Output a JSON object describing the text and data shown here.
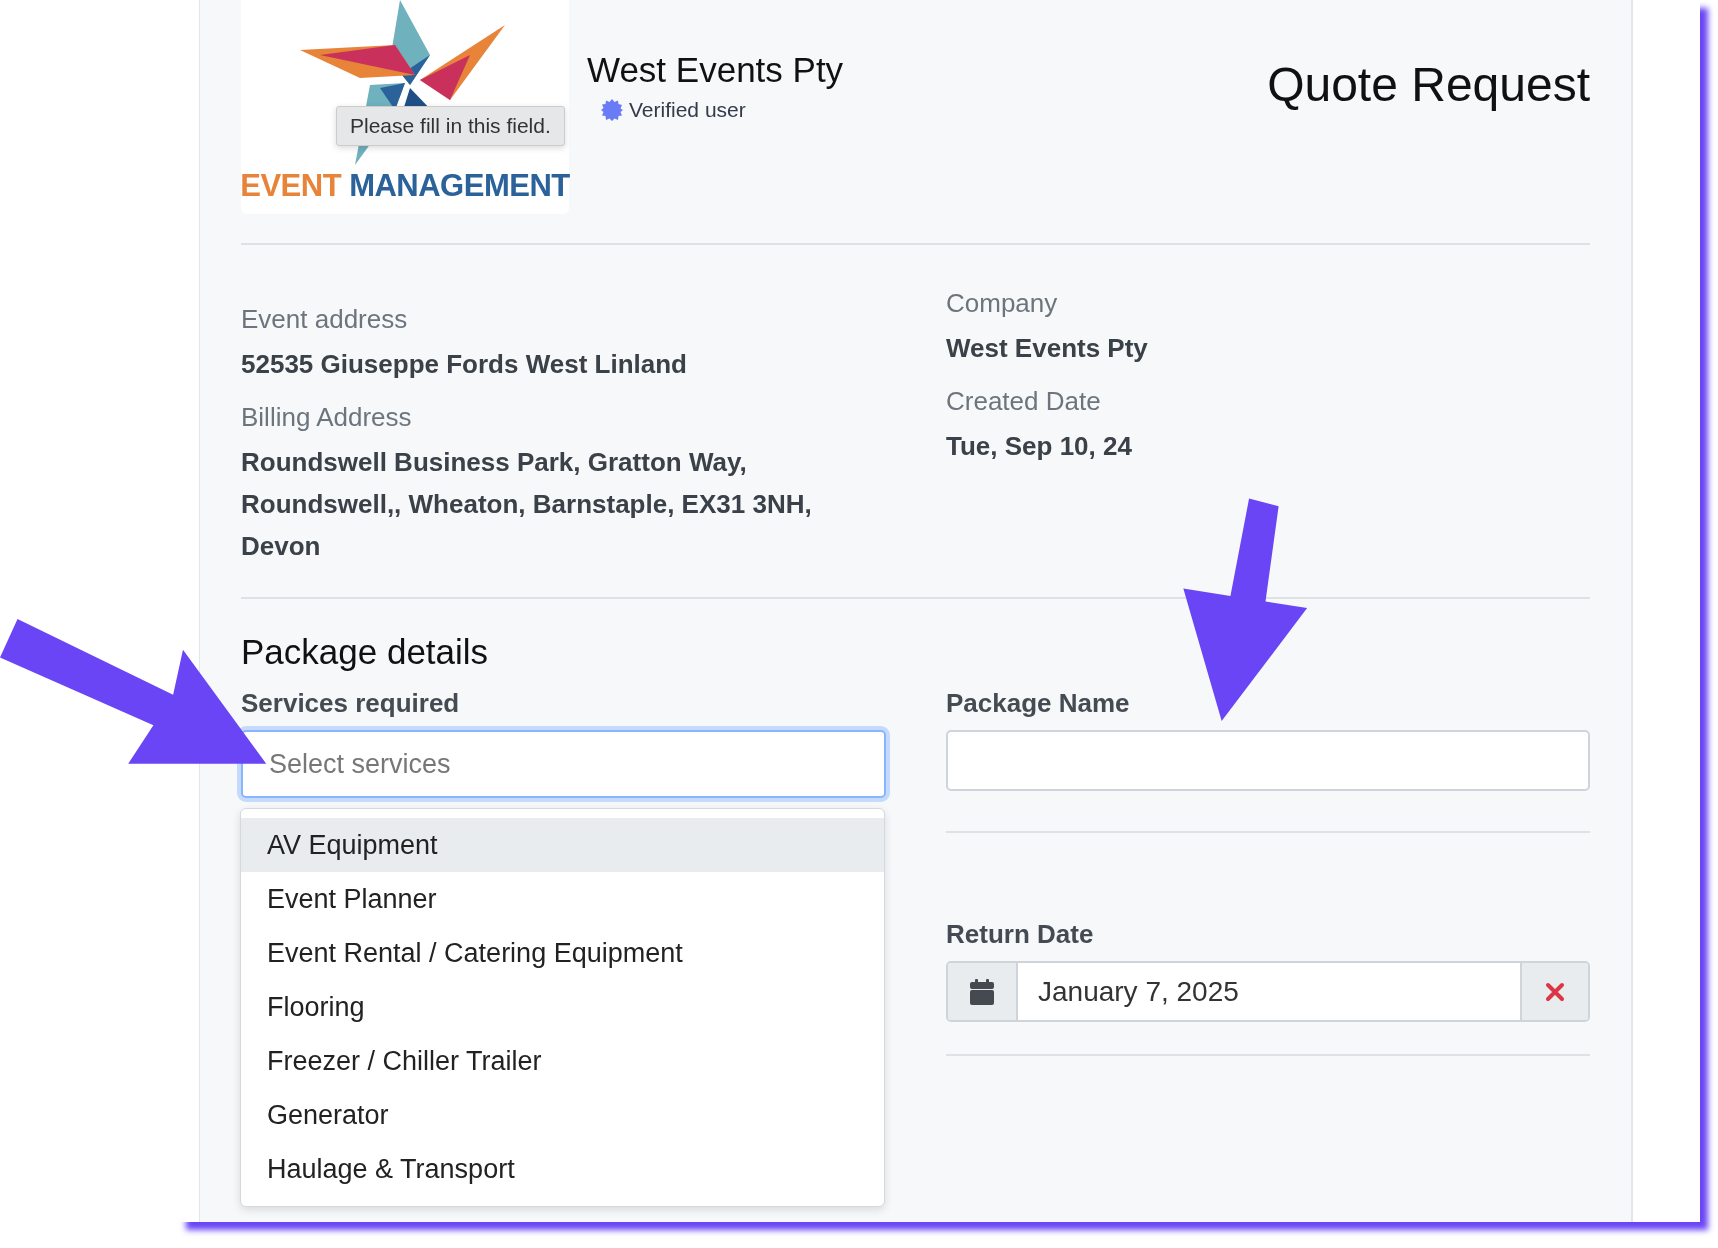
{
  "header": {
    "logo": {
      "words": [
        {
          "text": "EVENT",
          "color": "#e8833a"
        },
        {
          "text": "MANAGEMENT",
          "color": "#2a6299"
        }
      ]
    },
    "company_name": "West Events Pty",
    "verified_label": "Verified user",
    "title": "Quote Request"
  },
  "tooltip": "Please fill in this field.",
  "details_left": [
    {
      "label": "Event address",
      "lines": [
        "52535 Giuseppe Fords West Linland"
      ]
    },
    {
      "label": "Billing Address",
      "lines": [
        "Roundswell Business Park, Gratton Way,",
        "Roundswell,, Wheaton, Barnstaple, EX31 3NH,",
        "Devon"
      ]
    }
  ],
  "details_right": [
    {
      "label": "Company",
      "lines": [
        "West Events Pty"
      ]
    },
    {
      "label": "Created Date",
      "lines": [
        "Tue, Sep 10, 24"
      ]
    }
  ],
  "package": {
    "heading": "Package details",
    "services": {
      "label": "Services required",
      "placeholder": "Select services",
      "focused": true
    },
    "options": [
      {
        "label": "AV Equipment",
        "highlighted": true
      },
      {
        "label": "Event Planner",
        "highlighted": false
      },
      {
        "label": "Event Rental / Catering Equipment",
        "highlighted": false
      },
      {
        "label": "Flooring",
        "highlighted": false
      },
      {
        "label": "Freezer / Chiller Trailer",
        "highlighted": false
      },
      {
        "label": "Generator",
        "highlighted": false
      },
      {
        "label": "Haulage & Transport",
        "highlighted": false
      }
    ],
    "package_name": {
      "label": "Package Name"
    },
    "return_date": {
      "label": "Return Date",
      "value": "January 7, 2025"
    }
  }
}
